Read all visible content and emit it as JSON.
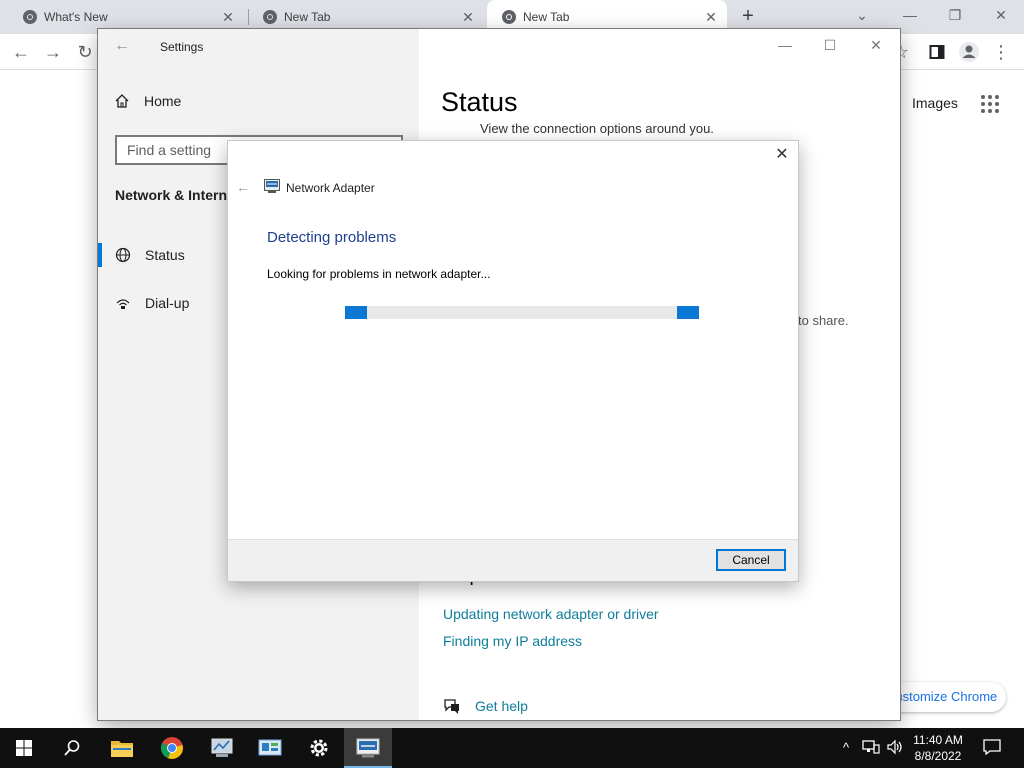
{
  "chrome": {
    "tabs": [
      {
        "title": "What's New",
        "active": false
      },
      {
        "title": "New Tab",
        "active": false
      },
      {
        "title": "New Tab",
        "active": true
      }
    ],
    "new_tab_symbol": "+",
    "images_link": "Images",
    "customize_label": "Customize Chrome",
    "icons": [
      "chrome-logo-icon",
      "back-arrow-icon",
      "forward-arrow-icon",
      "reload-icon",
      "star-icon",
      "side-panel-icon",
      "profile-icon",
      "more-menu-icon",
      "apps-grid-icon"
    ]
  },
  "settings": {
    "window_title": "Settings",
    "home_label": "Home",
    "search_placeholder": "Find a setting",
    "section_title": "Network & Internet",
    "nav_items": [
      {
        "label": "Status",
        "selected": true,
        "icon": "globe-icon"
      },
      {
        "label": "Dial-up",
        "selected": false,
        "icon": "dialup-icon"
      }
    ],
    "main_title": "Status",
    "main_subtext": "View the connection options around you.",
    "share_text_fragment": "to share.",
    "help_heading": "Help from the web",
    "help_links": [
      "Updating network adapter or driver",
      "Finding my IP address"
    ],
    "get_help_label": "Get help"
  },
  "dialog": {
    "app_title": "Network Adapter",
    "heading": "Detecting problems",
    "status_text": "Looking for problems in network adapter...",
    "cancel_label": "Cancel",
    "accent_color": "#0078d7"
  },
  "taskbar": {
    "apps": [
      "start-icon",
      "search-icon",
      "file-explorer-icon",
      "chrome-icon",
      "network-app-icon",
      "control-panel-icon",
      "settings-gear-icon",
      "troubleshooter-icon"
    ],
    "active_app": "troubleshooter-icon",
    "time": "11:40 AM",
    "date": "8/8/2022",
    "tray_icons": [
      "chevron-up-icon",
      "network-icon",
      "volume-icon",
      "notification-icon"
    ]
  }
}
